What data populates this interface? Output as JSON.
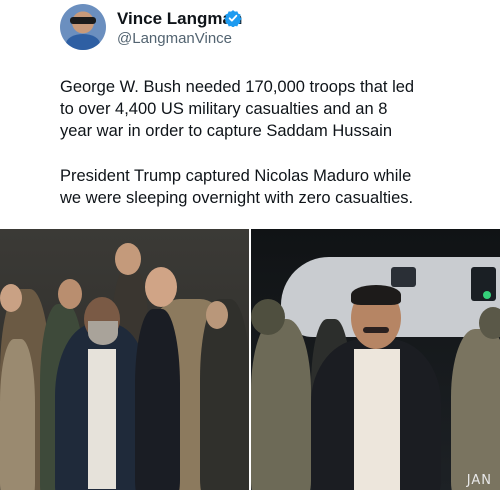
{
  "author": {
    "name": "Vince Langman",
    "handle": "@LangmanVince",
    "verified_color": "#1d9bf0"
  },
  "tweet": {
    "paragraph1": "George W. Bush needed 170,000 troops that led\nto over 4,400 US military casualties and an 8\nyear war in order to capture Saddam Hussain",
    "paragraph2": "President Trump captured Nicolas Maduro while\nwe were sleeping overnight with zero casualties."
  },
  "media": {
    "watermark": "JAN"
  }
}
